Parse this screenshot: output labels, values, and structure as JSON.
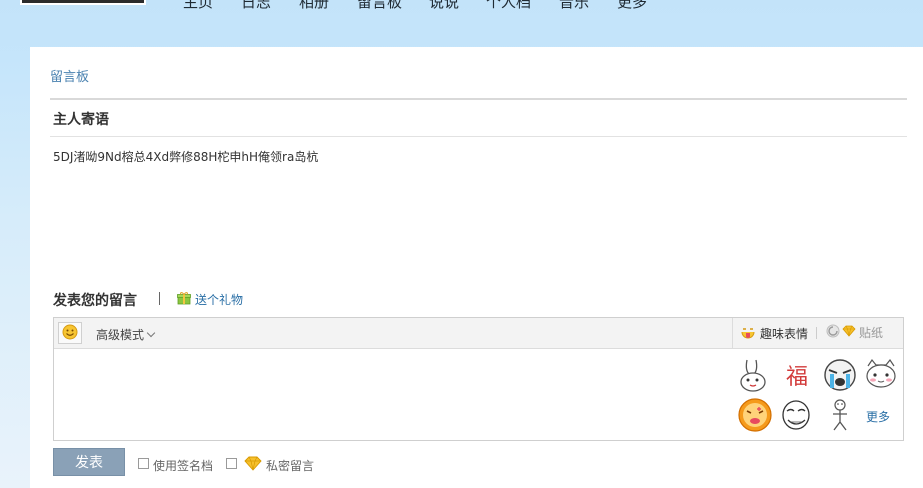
{
  "nav": {
    "items": [
      "主页",
      "日志",
      "相册",
      "留言板",
      "说说",
      "个人档",
      "音乐",
      "更多"
    ]
  },
  "breadcrumb": "留言板",
  "owner": {
    "title": "主人寄语",
    "message": "5DJ渚呦9Nd榕总4Xd弊修88H柁申hH俺领ra岛杭"
  },
  "compose": {
    "title": "发表您的留言",
    "gift_label": "送个礼物",
    "mode_label": "高级模式",
    "fun_emoji_tab": "趣味表情",
    "sticker_tab": "贴纸",
    "more_emoji": "更多",
    "submit_label": "发表",
    "signature_label": "使用签名档",
    "private_label": "私密留言"
  },
  "emoji": [
    "rabbit-emoji",
    "fu-character-emoji",
    "crying-face-emoji",
    "cat-emoji",
    "cookie-face-emoji",
    "rage-face-emoji",
    "stick-figure-emoji"
  ],
  "colors": {
    "accent": "#2a6fa6",
    "submit": "#8aa1b7",
    "background": "#c5e5fb"
  }
}
